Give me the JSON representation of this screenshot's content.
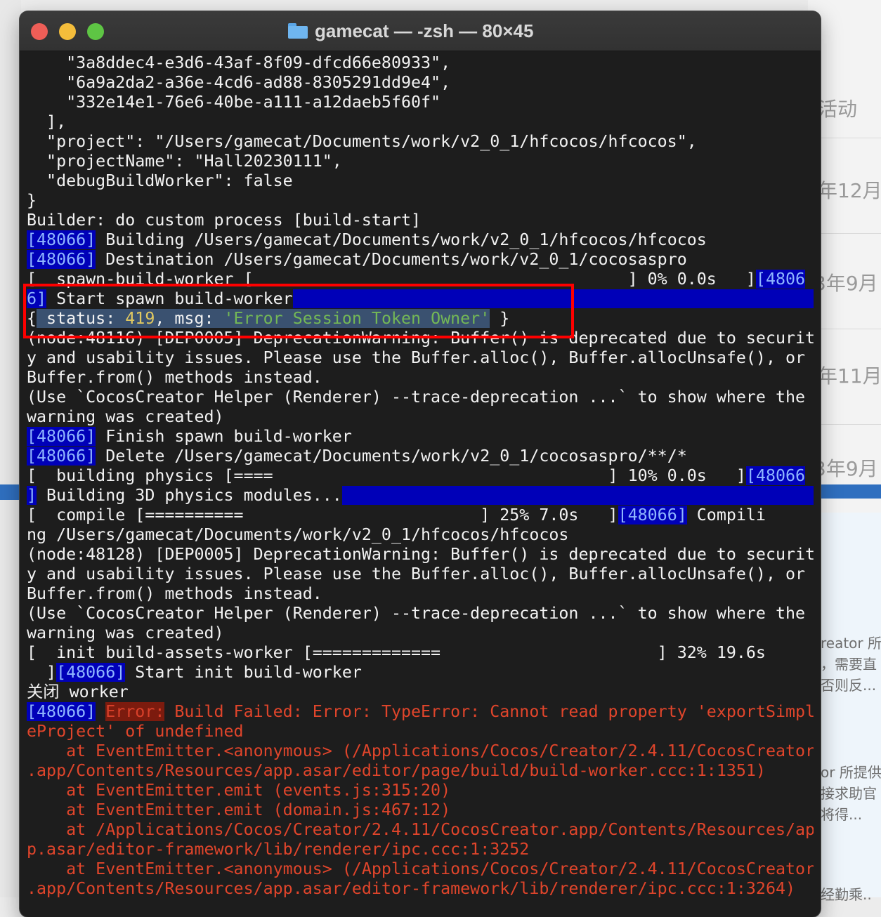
{
  "window": {
    "title": "gamecat — -zsh — 80×45",
    "icon": "folder-icon",
    "controls": [
      "close",
      "minimize",
      "zoom"
    ]
  },
  "background": {
    "labels": [
      "活动",
      "年12月",
      "3年9月",
      "年11月",
      "3年9月"
    ],
    "snippets": [
      "reator 所",
      "，需要直",
      "否则反...",
      "or 所提供",
      "接求助官",
      "将得...",
      "经勤乘.."
    ]
  },
  "terminal": {
    "lines": [
      [
        {
          "t": "    \"3a8ddec4-e3d6-43af-8f09-dfcd66e80933\","
        }
      ],
      [
        {
          "t": "    \"6a9a2da2-a36e-4cd6-ad88-8305291dd9e4\","
        }
      ],
      [
        {
          "t": "    \"332e14e1-76e6-40be-a111-a12daeb5f60f\""
        }
      ],
      [
        {
          "t": "  ],"
        }
      ],
      [
        {
          "t": "  \"project\": \"/Users/gamecat/Documents/work/v2_0_1/hfcocos/hfcocos\","
        }
      ],
      [
        {
          "t": "  \"projectName\": \"Hall20230111\","
        }
      ],
      [
        {
          "t": "  \"debugBuildWorker\": false"
        }
      ],
      [
        {
          "t": "}"
        }
      ],
      [
        {
          "t": "Builder: do custom process [build-start]"
        }
      ],
      [
        {
          "t": "[48066]",
          "c": "pid"
        },
        {
          "t": " Building /Users/gamecat/Documents/work/v2_0_1/hfcocos/hfcocos"
        }
      ],
      [
        {
          "t": "[48066]",
          "c": "pid"
        },
        {
          "t": " Destination /Users/gamecat/Documents/work/v2_0_1/cocosaspro"
        }
      ],
      [
        {
          "t": "[  spawn-build-worker [                                      ] 0% 0.0s   ]"
        },
        {
          "t": "[4806",
          "c": "pid"
        }
      ],
      [
        {
          "t": "6]",
          "c": "pid"
        },
        {
          "t": " Start spawn build-worker"
        },
        {
          "t": "                                                       ",
          "c": "hlfill"
        }
      ],
      [
        {
          "t": "{"
        },
        {
          "t": " status: ",
          "c": "sel"
        },
        {
          "t": "419",
          "c": "sel num"
        },
        {
          "t": ", msg: ",
          "c": "sel"
        },
        {
          "t": "'Error Session Token Owner'",
          "c": "sel str"
        },
        {
          "t": " }"
        }
      ],
      [
        {
          "t": "(node:48116) [DEP0005] DeprecationWarning: Buffer() is deprecated due to securit"
        }
      ],
      [
        {
          "t": "y and usability issues. Please use the Buffer.alloc(), Buffer.allocUnsafe(), or"
        }
      ],
      [
        {
          "t": "Buffer.from() methods instead."
        }
      ],
      [
        {
          "t": "(Use `CocosCreator Helper (Renderer) --trace-deprecation ...` to show where the"
        }
      ],
      [
        {
          "t": "warning was created)"
        }
      ],
      [
        {
          "t": "[48066]",
          "c": "pid"
        },
        {
          "t": " Finish spawn build-worker"
        }
      ],
      [
        {
          "t": "[48066]",
          "c": "pid"
        },
        {
          "t": " Delete /Users/gamecat/Documents/work/v2_0_1/cocosaspro/**/*"
        }
      ],
      [
        {
          "t": "[  building physics [====                                  ] 10% 0.0s   ]"
        },
        {
          "t": "[48066",
          "c": "pid"
        }
      ],
      [
        {
          "t": "]",
          "c": "pid"
        },
        {
          "t": " Building 3D physics modules..."
        },
        {
          "t": "                                                 ",
          "c": "hlfill"
        }
      ],
      [
        {
          "t": "[  compile [==========                        ] 25% 7.0s   ]"
        },
        {
          "t": "[48066]",
          "c": "pid"
        },
        {
          "t": " Compili"
        }
      ],
      [
        {
          "t": "ng /Users/gamecat/Documents/work/v2_0_1/hfcocos/hfcocos"
        }
      ],
      [
        {
          "t": "(node:48128) [DEP0005] DeprecationWarning: Buffer() is deprecated due to securit"
        }
      ],
      [
        {
          "t": "y and usability issues. Please use the Buffer.alloc(), Buffer.allocUnsafe(), or"
        }
      ],
      [
        {
          "t": "Buffer.from() methods instead."
        }
      ],
      [
        {
          "t": "(Use `CocosCreator Helper (Renderer) --trace-deprecation ...` to show where the"
        }
      ],
      [
        {
          "t": "warning was created)"
        }
      ],
      [
        {
          "t": "[  init build-assets-worker [=============                      ] 32% 19.6s"
        }
      ],
      [
        {
          "t": "  ]"
        },
        {
          "t": "[48066]",
          "c": "pid"
        },
        {
          "t": " Start init build-worker"
        }
      ],
      [
        {
          "t": "关闭 worker"
        }
      ],
      [
        {
          "t": "[48066]",
          "c": "pid"
        },
        {
          "t": " "
        },
        {
          "t": "Error:",
          "c": "errtag"
        },
        {
          "t": " Build Failed: Error: TypeError: Cannot read property 'exportSimpl",
          "c": "err"
        }
      ],
      [
        {
          "t": "eProject' of undefined",
          "c": "err"
        }
      ],
      [
        {
          "t": "    at EventEmitter.<anonymous> (/Applications/Cocos/Creator/2.4.11/CocosCreator",
          "c": "err"
        }
      ],
      [
        {
          "t": ".app/Contents/Resources/app.asar/editor/page/build/build-worker.ccc:1:1351)",
          "c": "err"
        }
      ],
      [
        {
          "t": "    at EventEmitter.emit (events.js:315:20)",
          "c": "err"
        }
      ],
      [
        {
          "t": "    at EventEmitter.emit (domain.js:467:12)",
          "c": "err"
        }
      ],
      [
        {
          "t": "    at /Applications/Cocos/Creator/2.4.11/CocosCreator.app/Contents/Resources/ap",
          "c": "err"
        }
      ],
      [
        {
          "t": "p.asar/editor-framework/lib/renderer/ipc.ccc:1:3252",
          "c": "err"
        }
      ],
      [
        {
          "t": "    at EventEmitter.<anonymous> (/Applications/Cocos/Creator/2.4.11/CocosCreator",
          "c": "err"
        }
      ],
      [
        {
          "t": ".app/Contents/Resources/app.asar/editor-framework/lib/renderer/ipc.ccc:1:3264)",
          "c": "err"
        }
      ]
    ]
  },
  "colors": {
    "terminal_bg": "#1d1d1d",
    "text": "#f2f2f2",
    "pid_highlight": "#0000b8",
    "error_text": "#e0452b",
    "annotation_box": "#ff0000"
  }
}
